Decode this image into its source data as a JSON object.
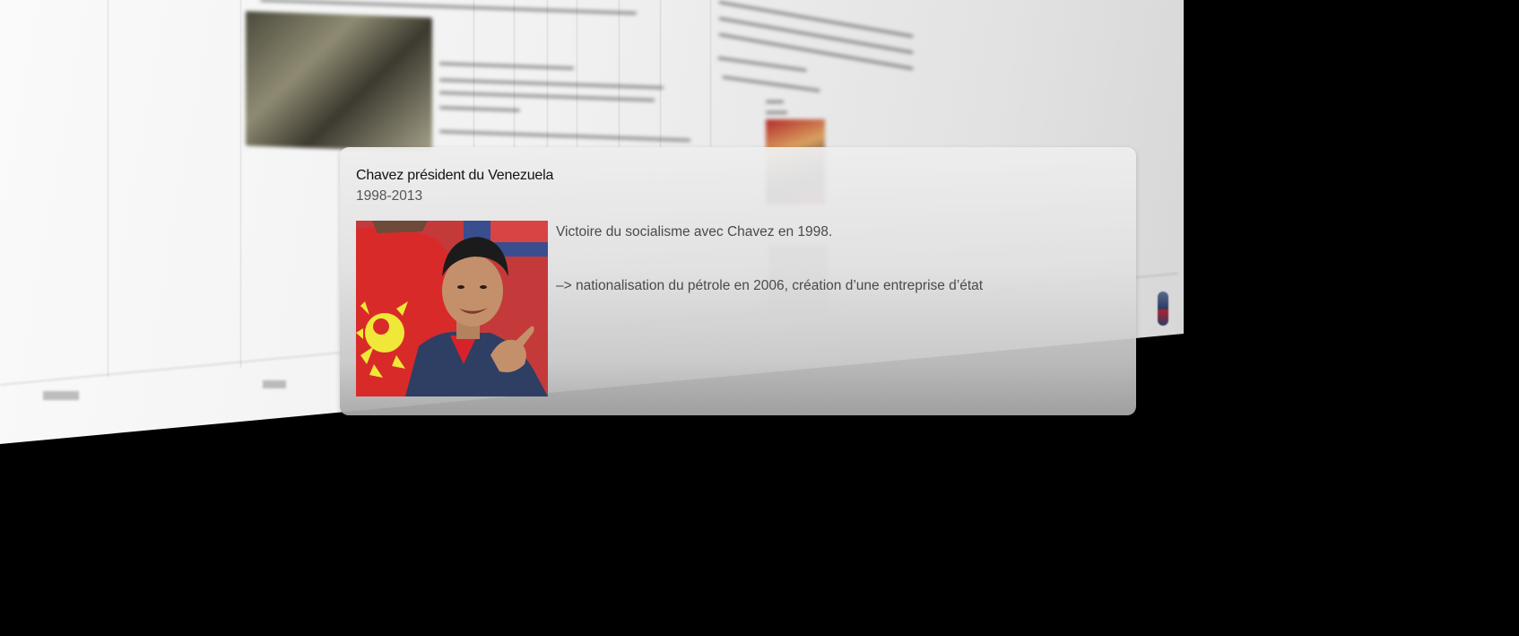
{
  "event": {
    "title": "Chavez président du Venezuela",
    "dates": "1998-2013",
    "description_line_1": "Victoire du socialisme avec Chavez en 1998.",
    "description_line_2": "–> nationalisation du pétrole en 2006, création d’une entreprise d’état",
    "photo_subject": "person-photo"
  },
  "colors": {
    "background": "#000000",
    "card_top": "#eeeeee",
    "card_bottom": "#a8a8a8",
    "title_text": "#111111",
    "body_text": "#4a4a4a"
  }
}
